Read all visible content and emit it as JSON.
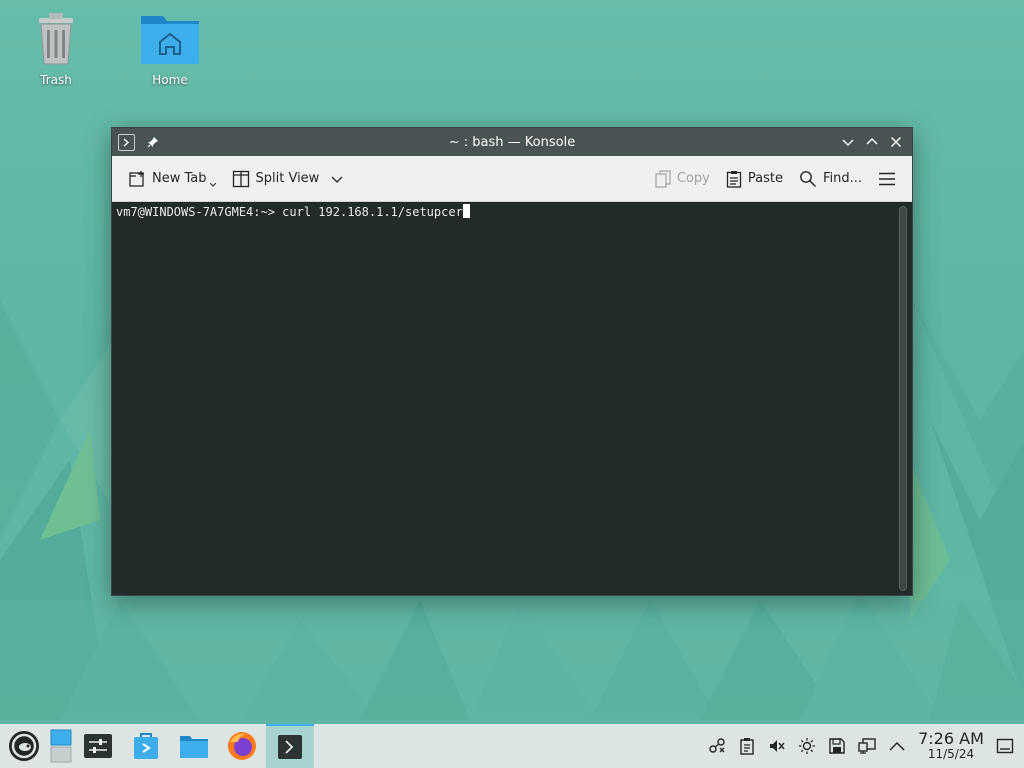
{
  "desktop": {
    "icons": [
      {
        "label": "Trash",
        "icon": "trash-icon"
      },
      {
        "label": "Home",
        "icon": "home-folder-icon"
      }
    ]
  },
  "window": {
    "title": "~ : bash — Konsole",
    "toolbar": {
      "new_tab": "New Tab",
      "split_view": "Split View",
      "copy": "Copy",
      "paste": "Paste",
      "find": "Find..."
    },
    "terminal": {
      "prompt": "vm7@WINDOWS-7A7GME4:~> ",
      "command": "curl 192.168.1.1/setupcer"
    }
  },
  "taskbar": {
    "apps": [
      {
        "name": "application-launcher",
        "icon": "opensuse-icon"
      },
      {
        "name": "pager",
        "icon": "pager-icon"
      },
      {
        "name": "system-settings",
        "icon": "settings-icon"
      },
      {
        "name": "discover",
        "icon": "discover-icon"
      },
      {
        "name": "dolphin",
        "icon": "folder-icon"
      },
      {
        "name": "firefox",
        "icon": "firefox-icon"
      },
      {
        "name": "konsole",
        "icon": "terminal-icon"
      }
    ],
    "clock": {
      "time": "7:26 AM",
      "date": "11/5/24"
    }
  },
  "colors": {
    "desktop": "#62b8a6",
    "titlebar": "#4a5354",
    "terminal_bg": "#232a2a",
    "taskbar": "#dde5e4",
    "active_task": "#a6d3cf"
  }
}
